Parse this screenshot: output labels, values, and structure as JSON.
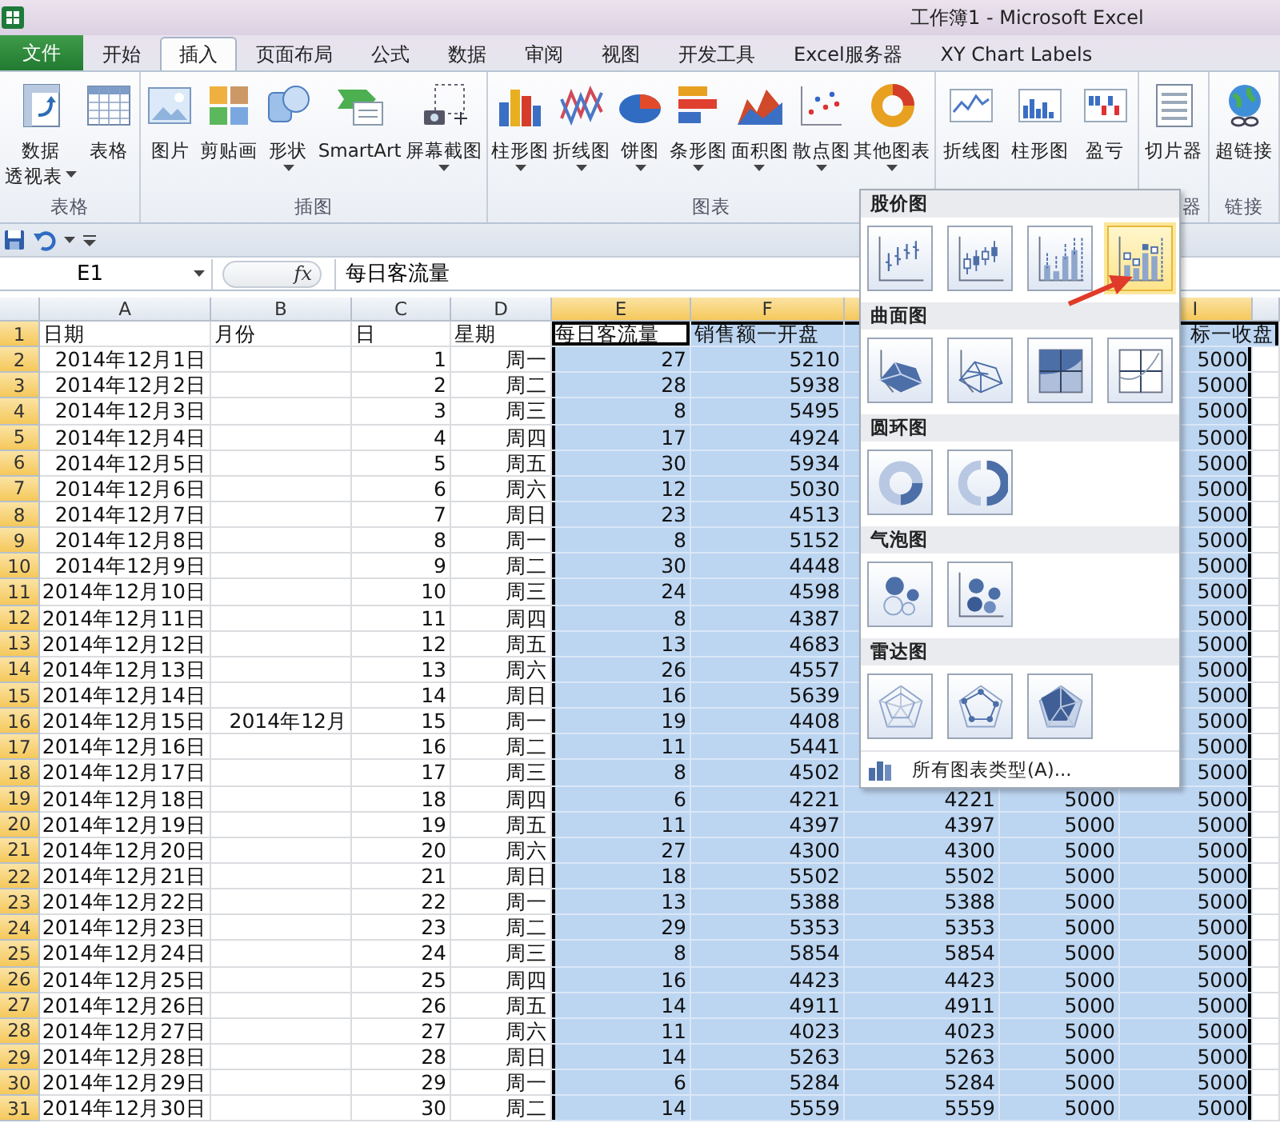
{
  "window": {
    "title": "工作簿1 - Microsoft Excel"
  },
  "tabs": [
    {
      "label": "文件",
      "kind": "file",
      "selected": false
    },
    {
      "label": "开始",
      "kind": "tab",
      "selected": false
    },
    {
      "label": "插入",
      "kind": "tab",
      "selected": true
    },
    {
      "label": "页面布局",
      "kind": "tab",
      "selected": false
    },
    {
      "label": "公式",
      "kind": "tab",
      "selected": false
    },
    {
      "label": "数据",
      "kind": "tab",
      "selected": false
    },
    {
      "label": "审阅",
      "kind": "tab",
      "selected": false
    },
    {
      "label": "视图",
      "kind": "tab",
      "selected": false
    },
    {
      "label": "开发工具",
      "kind": "tab",
      "selected": false
    },
    {
      "label": "Excel服务器",
      "kind": "tab",
      "selected": false
    },
    {
      "label": "XY Chart Labels",
      "kind": "tab",
      "selected": false
    }
  ],
  "ribbon_groups": [
    {
      "label": "表格",
      "buttons": [
        {
          "lines": [
            "数据",
            "透视表"
          ],
          "kind": "pivot",
          "menu": true
        },
        {
          "lines": [
            "表格"
          ],
          "kind": "table",
          "menu": false
        }
      ]
    },
    {
      "label": "插图",
      "buttons": [
        {
          "lines": [
            "图片"
          ],
          "kind": "picture",
          "menu": false
        },
        {
          "lines": [
            "剪贴画"
          ],
          "kind": "clipart",
          "menu": false
        },
        {
          "lines": [
            "形状"
          ],
          "kind": "shapes",
          "menu": true
        },
        {
          "lines": [
            "SmartArt"
          ],
          "kind": "smartart",
          "menu": false
        },
        {
          "lines": [
            "屏幕截图"
          ],
          "kind": "screenshot",
          "menu": true
        }
      ]
    },
    {
      "label": "图表",
      "buttons": [
        {
          "lines": [
            "柱形图"
          ],
          "kind": "column",
          "menu": true
        },
        {
          "lines": [
            "折线图"
          ],
          "kind": "line",
          "menu": true
        },
        {
          "lines": [
            "饼图"
          ],
          "kind": "pie",
          "menu": true
        },
        {
          "lines": [
            "条形图"
          ],
          "kind": "bar",
          "menu": true
        },
        {
          "lines": [
            "面积图"
          ],
          "kind": "area",
          "menu": true
        },
        {
          "lines": [
            "散点图"
          ],
          "kind": "scatter",
          "menu": true
        },
        {
          "lines": [
            "其他图表"
          ],
          "kind": "other",
          "menu": true
        }
      ]
    },
    {
      "buttons": [
        {
          "lines": [
            "折线图"
          ],
          "kind": "spark-line",
          "menu": false
        },
        {
          "lines": [
            "柱形图"
          ],
          "kind": "spark-column",
          "menu": false
        },
        {
          "lines": [
            "盈亏"
          ],
          "kind": "win-loss",
          "menu": false
        }
      ]
    },
    {
      "label": "器",
      "buttons": [
        {
          "lines": [
            "切片器"
          ],
          "kind": "slicer",
          "menu": false
        }
      ]
    },
    {
      "label": "链接",
      "buttons": [
        {
          "lines": [
            "超链接"
          ],
          "kind": "hyperlink",
          "menu": false
        }
      ]
    }
  ],
  "formula_bar": {
    "cell": "E1",
    "function_button": "fx",
    "value": "每日客流量"
  },
  "sheet": {
    "columns": [
      {
        "label": "A",
        "selected": false
      },
      {
        "label": "B",
        "selected": false
      },
      {
        "label": "C",
        "selected": false
      },
      {
        "label": "D",
        "selected": false
      },
      {
        "label": "E",
        "selected": true
      },
      {
        "label": "F",
        "selected": true
      },
      {
        "selected": true
      },
      {
        "selected": true
      },
      {
        "label": "I",
        "selected": true
      }
    ],
    "rows": [
      {
        "number": "1",
        "kind": "header",
        "selected": true,
        "cells": [
          "日期",
          "月份",
          "日",
          "星期",
          {
            "text": "每日客流量",
            "active": true
          },
          "销售额一开盘",
          null,
          null,
          "标一收盘"
        ]
      },
      {
        "number": "2",
        "kind": "data",
        "selected": true,
        "cells": [
          "2014年12月1日",
          null,
          "1",
          "周一",
          "27",
          "5210",
          null,
          null,
          "5000"
        ]
      },
      {
        "number": "3",
        "kind": "data",
        "selected": true,
        "cells": [
          "2014年12月2日",
          null,
          "2",
          "周二",
          "28",
          "5938",
          null,
          null,
          "5000"
        ]
      },
      {
        "number": "4",
        "kind": "data",
        "selected": true,
        "cells": [
          "2014年12月3日",
          null,
          "3",
          "周三",
          "8",
          "5495",
          null,
          null,
          "5000"
        ]
      },
      {
        "number": "5",
        "kind": "data",
        "selected": true,
        "cells": [
          "2014年12月4日",
          null,
          "4",
          "周四",
          "17",
          "4924",
          null,
          null,
          "5000"
        ]
      },
      {
        "number": "6",
        "kind": "data",
        "selected": true,
        "cells": [
          "2014年12月5日",
          null,
          "5",
          "周五",
          "30",
          "5934",
          null,
          null,
          "5000"
        ]
      },
      {
        "number": "7",
        "kind": "data",
        "selected": true,
        "cells": [
          "2014年12月6日",
          null,
          "6",
          "周六",
          "12",
          "5030",
          null,
          null,
          "5000"
        ]
      },
      {
        "number": "8",
        "kind": "data",
        "selected": true,
        "cells": [
          "2014年12月7日",
          null,
          "7",
          "周日",
          "23",
          "4513",
          null,
          null,
          "5000"
        ]
      },
      {
        "number": "9",
        "kind": "data",
        "selected": true,
        "cells": [
          "2014年12月8日",
          null,
          "8",
          "周一",
          "8",
          "5152",
          null,
          null,
          "5000"
        ]
      },
      {
        "number": "10",
        "kind": "data",
        "selected": true,
        "cells": [
          "2014年12月9日",
          null,
          "9",
          "周二",
          "30",
          "4448",
          null,
          null,
          "5000"
        ]
      },
      {
        "number": "11",
        "kind": "data",
        "selected": true,
        "cells": [
          "2014年12月10日",
          null,
          "10",
          "周三",
          "24",
          "4598",
          null,
          null,
          "5000"
        ]
      },
      {
        "number": "12",
        "kind": "data",
        "selected": true,
        "cells": [
          "2014年12月11日",
          null,
          "11",
          "周四",
          "8",
          "4387",
          null,
          null,
          "5000"
        ]
      },
      {
        "number": "13",
        "kind": "data",
        "selected": true,
        "cells": [
          "2014年12月12日",
          null,
          "12",
          "周五",
          "13",
          "4683",
          null,
          null,
          "5000"
        ]
      },
      {
        "number": "14",
        "kind": "data",
        "selected": true,
        "cells": [
          "2014年12月13日",
          null,
          "13",
          "周六",
          "26",
          "4557",
          null,
          null,
          "5000"
        ]
      },
      {
        "number": "15",
        "kind": "data",
        "selected": true,
        "cells": [
          "2014年12月14日",
          null,
          "14",
          "周日",
          "16",
          "5639",
          null,
          null,
          "5000"
        ]
      },
      {
        "number": "16",
        "kind": "data",
        "selected": true,
        "cells": [
          "2014年12月15日",
          "2014年12月",
          "15",
          "周一",
          "19",
          "4408",
          null,
          null,
          "5000"
        ]
      },
      {
        "number": "17",
        "kind": "data",
        "selected": true,
        "cells": [
          "2014年12月16日",
          null,
          "16",
          "周二",
          "11",
          "5441",
          null,
          null,
          "5000"
        ]
      },
      {
        "number": "18",
        "kind": "data",
        "selected": true,
        "cells": [
          "2014年12月17日",
          null,
          "17",
          "周三",
          "8",
          "4502",
          null,
          null,
          "5000"
        ]
      },
      {
        "number": "19",
        "kind": "data",
        "selected": true,
        "cells": [
          "2014年12月18日",
          null,
          "18",
          "周四",
          "6",
          "4221",
          "4221",
          "5000",
          "5000"
        ]
      },
      {
        "number": "20",
        "kind": "data",
        "selected": true,
        "cells": [
          "2014年12月19日",
          null,
          "19",
          "周五",
          "11",
          "4397",
          "4397",
          "5000",
          "5000"
        ]
      },
      {
        "number": "21",
        "kind": "data",
        "selected": true,
        "cells": [
          "2014年12月20日",
          null,
          "20",
          "周六",
          "27",
          "4300",
          "4300",
          "5000",
          "5000"
        ]
      },
      {
        "number": "22",
        "kind": "data",
        "selected": true,
        "cells": [
          "2014年12月21日",
          null,
          "21",
          "周日",
          "18",
          "5502",
          "5502",
          "5000",
          "5000"
        ]
      },
      {
        "number": "23",
        "kind": "data",
        "selected": true,
        "cells": [
          "2014年12月22日",
          null,
          "22",
          "周一",
          "13",
          "5388",
          "5388",
          "5000",
          "5000"
        ]
      },
      {
        "number": "24",
        "kind": "data",
        "selected": true,
        "cells": [
          "2014年12月23日",
          null,
          "23",
          "周二",
          "29",
          "5353",
          "5353",
          "5000",
          "5000"
        ]
      },
      {
        "number": "25",
        "kind": "data",
        "selected": true,
        "cells": [
          "2014年12月24日",
          null,
          "24",
          "周三",
          "8",
          "5854",
          "5854",
          "5000",
          "5000"
        ]
      },
      {
        "number": "26",
        "kind": "data",
        "selected": true,
        "cells": [
          "2014年12月25日",
          null,
          "25",
          "周四",
          "16",
          "4423",
          "4423",
          "5000",
          "5000"
        ]
      },
      {
        "number": "27",
        "kind": "data",
        "selected": true,
        "cells": [
          "2014年12月26日",
          null,
          "26",
          "周五",
          "14",
          "4911",
          "4911",
          "5000",
          "5000"
        ]
      },
      {
        "number": "28",
        "kind": "data",
        "selected": true,
        "cells": [
          "2014年12月27日",
          null,
          "27",
          "周六",
          "11",
          "4023",
          "4023",
          "5000",
          "5000"
        ]
      },
      {
        "number": "29",
        "kind": "data",
        "selected": true,
        "cells": [
          "2014年12月28日",
          null,
          "28",
          "周日",
          "14",
          "5263",
          "5263",
          "5000",
          "5000"
        ]
      },
      {
        "number": "30",
        "kind": "data",
        "selected": true,
        "cells": [
          "2014年12月29日",
          null,
          "29",
          "周一",
          "6",
          "5284",
          "5284",
          "5000",
          "5000"
        ]
      },
      {
        "number": "31",
        "kind": "data",
        "selected": true,
        "cells": [
          "2014年12月30日",
          null,
          "30",
          "周二",
          "14",
          "5559",
          "5559",
          "5000",
          "5000"
        ]
      }
    ]
  },
  "chart_menu": {
    "sections": [
      {
        "title": "股价图",
        "items": [
          {
            "kind": "stock-hlc",
            "selected": false
          },
          {
            "kind": "stock-ohlc",
            "selected": false
          },
          {
            "kind": "stock-vhlc",
            "selected": false
          },
          {
            "kind": "stock-vohlc",
            "selected": true
          }
        ]
      },
      {
        "title": "曲面图",
        "items": [
          {
            "kind": "surface-3d",
            "selected": false
          },
          {
            "kind": "surface-wire",
            "selected": false
          },
          {
            "kind": "contour",
            "selected": false
          },
          {
            "kind": "contour-wire",
            "selected": false
          }
        ]
      },
      {
        "title": "圆环图",
        "items": [
          {
            "kind": "doughnut",
            "selected": false
          },
          {
            "kind": "doughnut-exploded",
            "selected": false
          }
        ]
      },
      {
        "title": "气泡图",
        "items": [
          {
            "kind": "bubble",
            "selected": false
          },
          {
            "kind": "bubble-3d",
            "selected": false
          }
        ]
      },
      {
        "title": "雷达图",
        "items": [
          {
            "kind": "radar",
            "selected": false
          },
          {
            "kind": "radar-markers",
            "selected": false
          },
          {
            "kind": "radar-filled",
            "selected": false
          }
        ]
      }
    ],
    "footer": "所有图表类型(A)..."
  }
}
